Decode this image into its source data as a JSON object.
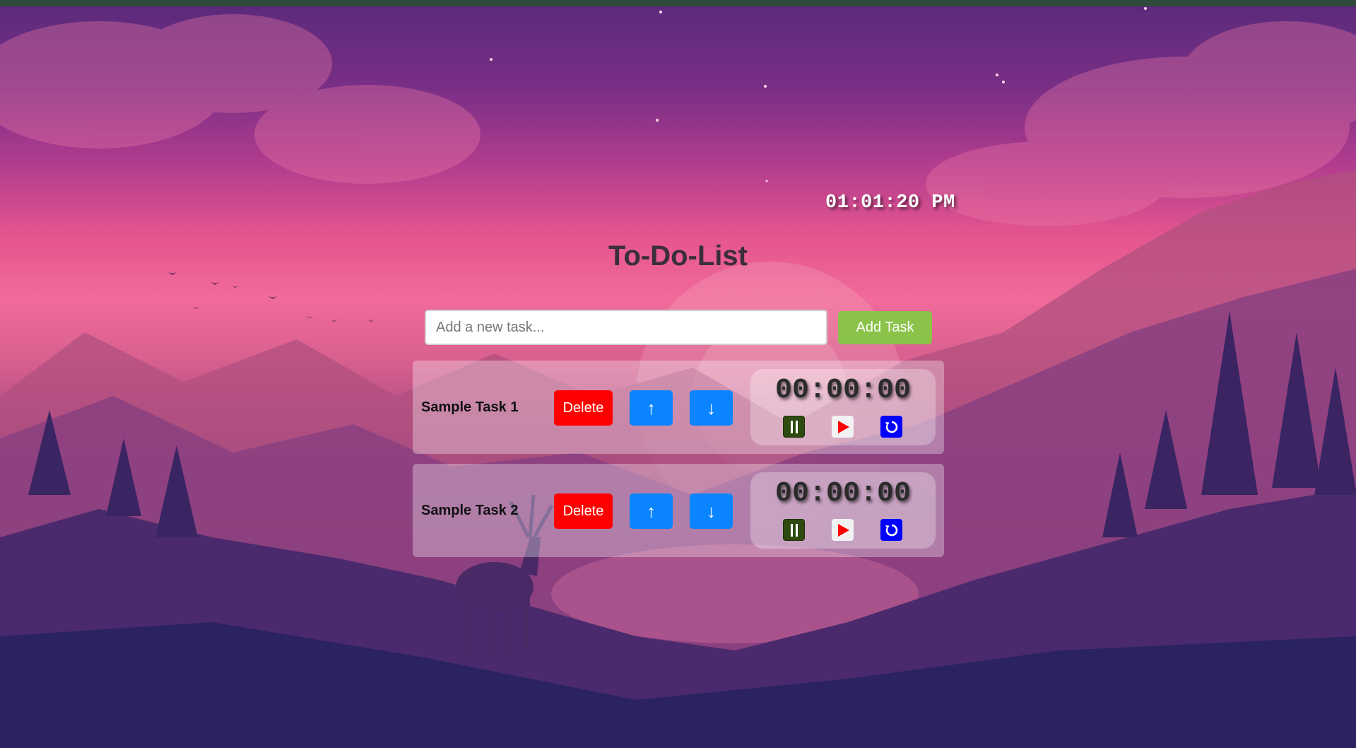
{
  "clock": {
    "time": "01:01:20 PM"
  },
  "header": {
    "title": "To-Do-List"
  },
  "add_task": {
    "placeholder": "Add a new task...",
    "value": "",
    "button_label": "Add Task"
  },
  "tasks": [
    {
      "name": "Sample Task 1",
      "delete_label": "Delete",
      "up_label": "↑",
      "down_label": "↓",
      "timer": "00:00:00"
    },
    {
      "name": "Sample Task 2",
      "delete_label": "Delete",
      "up_label": "↑",
      "down_label": "↓",
      "timer": "00:00:00"
    }
  ],
  "icons": {
    "pause": "pause-icon",
    "play": "play-icon",
    "reset": "reset-icon"
  },
  "colors": {
    "add_button": "#8bc34a",
    "delete_button": "#ff0000",
    "move_button": "#0a84ff",
    "pause_button": "#2f4a10",
    "play_icon": "#ff0000",
    "reset_button": "#0000ff"
  }
}
